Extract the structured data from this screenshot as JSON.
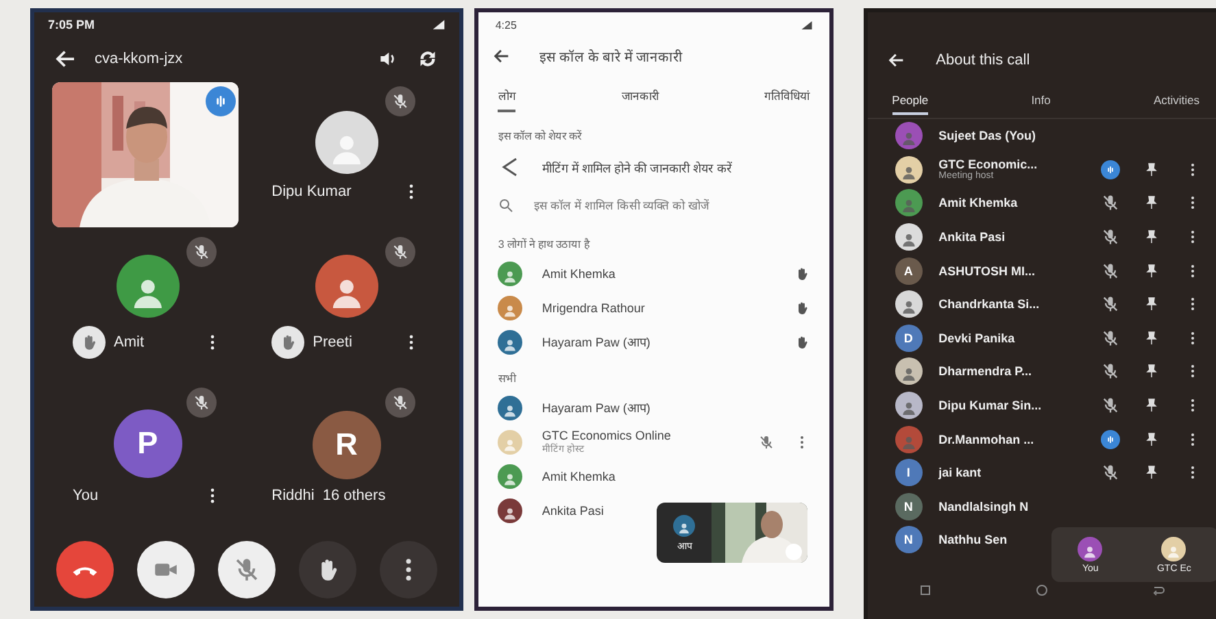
{
  "call_screen": {
    "status_bar": {
      "time": "7:05 PM"
    },
    "meeting_code": "cva-kkom-jzx",
    "tiles": [
      {
        "kind": "video",
        "muted": false
      },
      {
        "kind": "avatar",
        "name": "Dipu Kumar",
        "color": "#dcdcdc",
        "muted": true,
        "hand_raised": false,
        "menu": true
      },
      {
        "kind": "avatar",
        "name": "Amit",
        "muted": true,
        "hand_raised": true,
        "menu": true,
        "color": "#3f9a45"
      },
      {
        "kind": "avatar",
        "name": "Preeti",
        "muted": true,
        "hand_raised": true,
        "menu": true,
        "color": "#c8583f"
      },
      {
        "kind": "avatar",
        "name": "You",
        "initial": "P",
        "color": "#7d5bc4",
        "muted": true,
        "hand_raised": false,
        "menu": true
      },
      {
        "kind": "avatar",
        "name": "Riddhi",
        "initial": "R",
        "color": "#8a5a43",
        "muted": true,
        "hand_raised": false,
        "menu": false,
        "extra": "16 others"
      }
    ],
    "controls": [
      {
        "kind": "end"
      },
      {
        "kind": "camera"
      },
      {
        "kind": "mic"
      },
      {
        "kind": "hand"
      },
      {
        "kind": "more"
      }
    ]
  },
  "info_panel": {
    "status_bar": {
      "time": "4:25"
    },
    "title": "इस कॉल के बारे में जानकारी",
    "tabs": [
      {
        "label": "लोग",
        "selected": true
      },
      {
        "label": "जानकारी",
        "selected": false
      },
      {
        "label": "गतिविधियां",
        "selected": false
      }
    ],
    "share_label": "इस कॉल को शेयर करें",
    "share_text": "मीटिंग में शामिल होने की जानकारी शेयर करें",
    "search_placeholder": "इस कॉल में शामिल किसी व्यक्ति को खोजें",
    "raised_label": "3 लोगों ने हाथ उठाया है",
    "raised": [
      {
        "name": "Amit Khemka",
        "color": "#4c9a52"
      },
      {
        "name": "Mrigendra Rathour",
        "color": "#c98a4a"
      },
      {
        "name": "Hayaram Paw (आप)",
        "color": "#2f6f96"
      }
    ],
    "people_label": "सभी",
    "people": [
      {
        "name": "Hayaram Paw (आप)",
        "color": "#2f6f96",
        "muted": false
      },
      {
        "name": "GTC Economics Online",
        "subtitle": "मीटिंग होस्ट",
        "color": "#e3cfa6",
        "muted": true
      },
      {
        "name": "Amit Khemka",
        "color": "#4c9a52",
        "muted": false
      },
      {
        "name": "Ankita Pasi",
        "color": "#7a3a3a",
        "muted": false
      }
    ],
    "self_tile": {
      "label": "आप",
      "color": "#2f6f96"
    }
  },
  "people_panel": {
    "title": "About this call",
    "tabs": [
      {
        "label": "People",
        "selected": true
      },
      {
        "label": "Info",
        "selected": false
      },
      {
        "label": "Activities",
        "selected": false
      }
    ],
    "people": [
      {
        "name": "Sujeet Das (You)",
        "color": "#9b4fb5",
        "actions": false
      },
      {
        "name": "GTC Economic...",
        "subtitle": "Meeting host",
        "color": "#e3cfa6",
        "muted": false,
        "actions": true
      },
      {
        "name": "Amit Khemka",
        "color": "#4c9a52",
        "muted": true,
        "actions": true
      },
      {
        "name": "Ankita Pasi",
        "color": "#dcdcdc",
        "muted": true,
        "actions": true
      },
      {
        "name": "ASHUTOSH MI...",
        "initial": "A",
        "color": "#6a5a4c",
        "muted": true,
        "actions": true
      },
      {
        "name": "Chandrkanta Si...",
        "color": "#d8d8d8",
        "muted": true,
        "actions": true
      },
      {
        "name": "Devki Panika",
        "initial": "D",
        "color": "#4f79b8",
        "muted": true,
        "actions": true
      },
      {
        "name": "Dharmendra P...",
        "color": "#c8c0b0",
        "muted": true,
        "actions": true
      },
      {
        "name": "Dipu Kumar Sin...",
        "color": "#b8b8c8",
        "muted": true,
        "actions": true
      },
      {
        "name": "Dr.Manmohan ...",
        "color": "#b34a3a",
        "muted": false,
        "actions": true
      },
      {
        "name": "jai kant",
        "initial": "I",
        "color": "#4f79b8",
        "muted": true,
        "actions": true
      },
      {
        "name": "Nandlalsingh N",
        "initial": "N",
        "color": "#5a6a60",
        "actions": false
      },
      {
        "name": "Nathhu Sen",
        "initial": "N",
        "color": "#4f79b8",
        "actions": false
      }
    ],
    "floating": [
      {
        "label": "You",
        "color": "#9b4fb5"
      },
      {
        "label": "GTC Ec",
        "color": "#e3cfa6"
      }
    ]
  }
}
